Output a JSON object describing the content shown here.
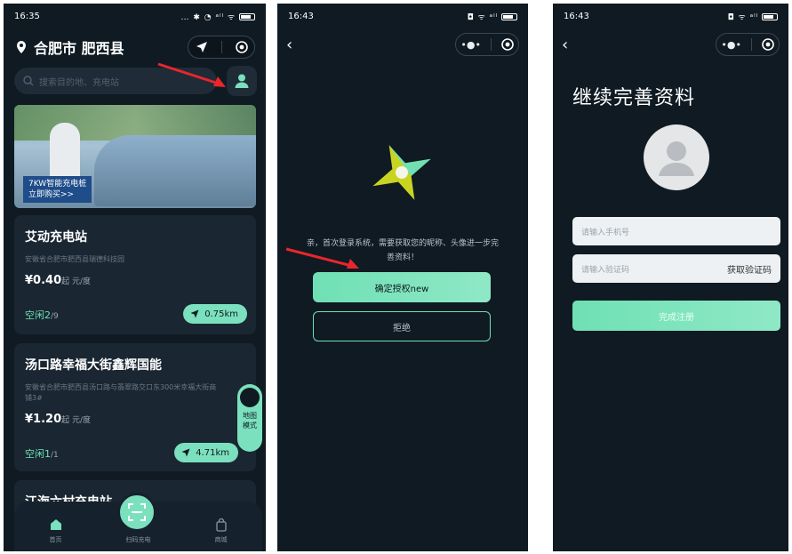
{
  "screens": {
    "home": {
      "status": {
        "time": "16:35",
        "icons": "… ✱ ◔ ᵃˡˡ ᯤ"
      },
      "location": "合肥市 肥西县",
      "search_placeholder": "搜索目的地、充电站",
      "banner": {
        "promo_line1": "7KW智能充电桩",
        "promo_line2": "立即购买>>"
      },
      "stations": [
        {
          "name": "艾动充电站",
          "address": "安徽省合肥市肥西县瑞德科技园",
          "price": "¥0.40",
          "price_unit": "起 元/度",
          "idle_label": "空闲",
          "idle_free": "2",
          "idle_total": "/9",
          "distance": "0.75km"
        },
        {
          "name": "汤口路幸福大街鑫辉国能",
          "address": "安徽省合肥市肥西县汤口路与翡翠路交口东300米幸福大街商铺3#",
          "price": "¥1.20",
          "price_unit": "起 元/度",
          "idle_label": "空闲",
          "idle_free": "1",
          "idle_total": "/1",
          "distance": "4.71km"
        },
        {
          "name": "江海六村充电站"
        }
      ],
      "map_mode_label": "地图模式",
      "tabs": [
        {
          "label": "首页"
        },
        {
          "label": "扫码充电"
        },
        {
          "label": "商城"
        }
      ]
    },
    "authorize": {
      "status": {
        "time": "16:43"
      },
      "message": "亲，首次登录系统，需要获取您的昵称、头像进一步完善资料！",
      "confirm_button": "确定授权new",
      "reject_button": "拒绝"
    },
    "profile": {
      "status": {
        "time": "16:43"
      },
      "title": "继续完善资料",
      "phone_placeholder": "请输入手机号",
      "code_placeholder": "请输入验证码",
      "get_code": "获取验证码",
      "submit": "完成注册"
    }
  },
  "colors": {
    "accent": "#7be0bd",
    "bg": "#0f1a22",
    "card": "#1a2632",
    "arrow": "#e8262b"
  }
}
